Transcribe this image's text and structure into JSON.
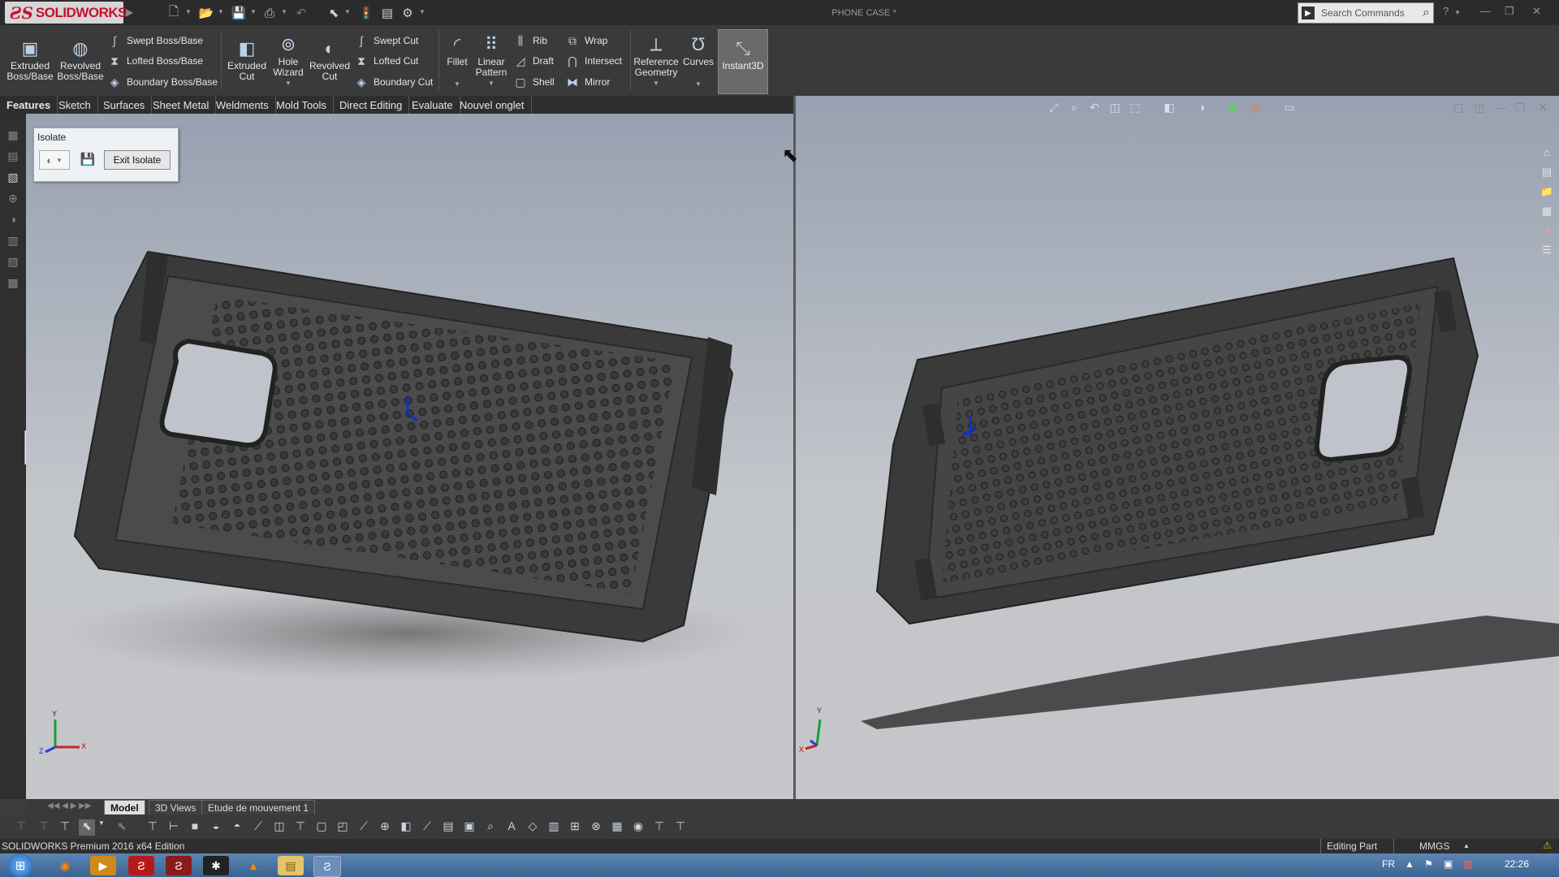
{
  "app": {
    "logo_text": "SOLIDWORKS",
    "document_title": "PHONE CASE *",
    "search_placeholder": "Search Commands",
    "status_edition": "SOLIDWORKS Premium 2016 x64 Edition",
    "status_mode": "Editing Part",
    "status_units": "MMGS",
    "lang": "FR",
    "clock": "22:26"
  },
  "ribbon": {
    "extruded_boss": "Extruded Boss/Base",
    "revolved_boss": "Revolved Boss/Base",
    "swept_boss": "Swept Boss/Base",
    "lofted_boss": "Lofted Boss/Base",
    "boundary_boss": "Boundary Boss/Base",
    "extruded_cut": "Extruded Cut",
    "hole_wizard": "Hole Wizard",
    "revolved_cut": "Revolved Cut",
    "swept_cut": "Swept Cut",
    "lofted_cut": "Lofted Cut",
    "boundary_cut": "Boundary Cut",
    "fillet": "Fillet",
    "linear_pattern": "Linear Pattern",
    "rib": "Rib",
    "draft": "Draft",
    "shell": "Shell",
    "wrap": "Wrap",
    "intersect": "Intersect",
    "mirror": "Mirror",
    "reference_geometry": "Reference Geometry",
    "curves": "Curves",
    "instant3d": "Instant3D"
  },
  "tabs": [
    "Features",
    "Sketch",
    "Surfaces",
    "Sheet Metal",
    "Weldments",
    "Mold Tools",
    "Direct Editing",
    "Evaluate",
    "Nouvel onglet"
  ],
  "isolate": {
    "title": "Isolate",
    "exit_label": "Exit Isolate"
  },
  "model_tabs": [
    "Model",
    "3D Views",
    "Etude de mouvement 1"
  ],
  "triad": {
    "x": "X",
    "y": "Y",
    "z": "Z"
  }
}
